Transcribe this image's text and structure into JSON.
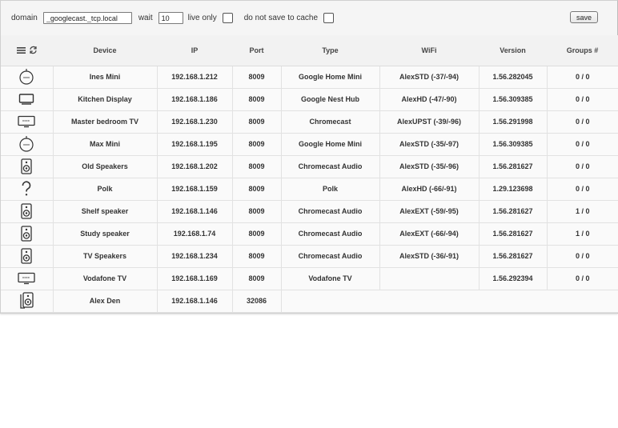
{
  "toolbar": {
    "domain_label": "domain",
    "domain_value": "_googlecast._tcp.local",
    "wait_label": "wait",
    "wait_value": "10",
    "live_only_label": "live only",
    "no_cache_label": "do not save to cache",
    "save_label": "save"
  },
  "table": {
    "headers": [
      "Device",
      "IP",
      "Port",
      "Type",
      "WiFi",
      "Version",
      "Groups #"
    ],
    "rows": [
      {
        "icon": "google-home-mini-icon",
        "device": "Ines Mini",
        "ip": "192.168.1.212",
        "port": "8009",
        "type": "Google Home Mini",
        "wifi": "AlexSTD (-37/-94)",
        "version": "1.56.282045",
        "groups": "0 / 0"
      },
      {
        "icon": "display-icon",
        "device": "Kitchen Display",
        "ip": "192.168.1.186",
        "port": "8009",
        "type": "Google Nest Hub",
        "wifi": "AlexHD (-47/-90)",
        "version": "1.56.309385",
        "groups": "0 / 0"
      },
      {
        "icon": "tv-icon",
        "device": "Master bedroom TV",
        "ip": "192.168.1.230",
        "port": "8009",
        "type": "Chromecast",
        "wifi": "AlexUPST (-39/-96)",
        "version": "1.56.291998",
        "groups": "0 / 0"
      },
      {
        "icon": "google-home-mini-icon",
        "device": "Max Mini",
        "ip": "192.168.1.195",
        "port": "8009",
        "type": "Google Home Mini",
        "wifi": "AlexSTD (-35/-97)",
        "version": "1.56.309385",
        "groups": "0 / 0"
      },
      {
        "icon": "speaker-icon",
        "device": "Old Speakers",
        "ip": "192.168.1.202",
        "port": "8009",
        "type": "Chromecast Audio",
        "wifi": "AlexSTD (-35/-96)",
        "version": "1.56.281627",
        "groups": "0 / 0"
      },
      {
        "icon": "question-icon",
        "device": "Polk",
        "ip": "192.168.1.159",
        "port": "8009",
        "type": "Polk",
        "wifi": "AlexHD (-66/-91)",
        "version": "1.29.123698",
        "groups": "0 / 0"
      },
      {
        "icon": "speaker-icon",
        "device": "Shelf speaker",
        "ip": "192.168.1.146",
        "port": "8009",
        "type": "Chromecast Audio",
        "wifi": "AlexEXT (-59/-95)",
        "version": "1.56.281627",
        "groups": "1 / 0"
      },
      {
        "icon": "speaker-icon",
        "device": "Study speaker",
        "ip": "192.168.1.74",
        "port": "8009",
        "type": "Chromecast Audio",
        "wifi": "AlexEXT (-66/-94)",
        "version": "1.56.281627",
        "groups": "1 / 0"
      },
      {
        "icon": "speaker-icon",
        "device": "TV Speakers",
        "ip": "192.168.1.234",
        "port": "8009",
        "type": "Chromecast Audio",
        "wifi": "AlexSTD (-36/-91)",
        "version": "1.56.281627",
        "groups": "0 / 0"
      },
      {
        "icon": "tv-icon",
        "device": "Vodafone TV",
        "ip": "192.168.1.169",
        "port": "8009",
        "type": "Vodafone TV",
        "wifi": "",
        "version": "1.56.292394",
        "groups": "0 / 0"
      },
      {
        "icon": "speaker-group-icon",
        "device": "Alex Den",
        "ip": "192.168.1.146",
        "port": "32086",
        "type": "",
        "wifi": "",
        "version": "",
        "groups": "",
        "span_rest": true
      }
    ]
  }
}
